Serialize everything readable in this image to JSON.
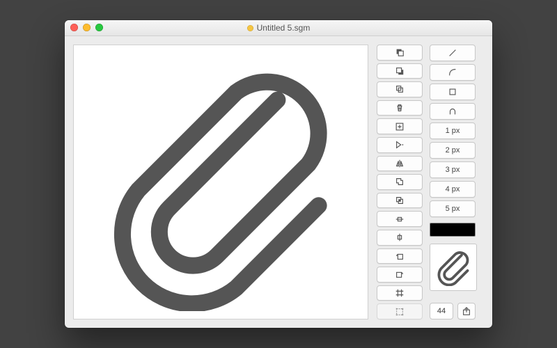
{
  "window": {
    "title": "Untitled 5.sgm"
  },
  "stroke_options": {
    "px1": "1 px",
    "px2": "2 px",
    "px3": "3 px",
    "px4": "4 px",
    "px5": "5 px"
  },
  "preview_size": "44",
  "current_color": "#000000"
}
